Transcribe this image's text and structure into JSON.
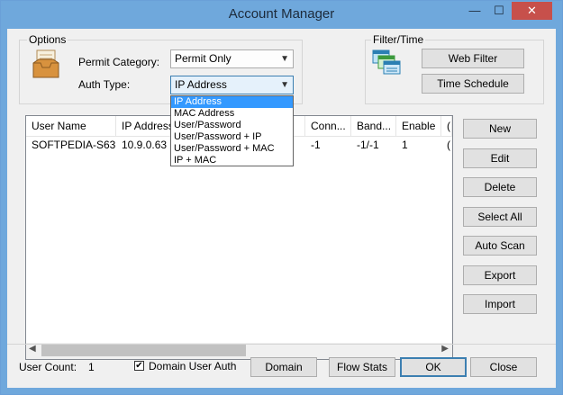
{
  "window": {
    "title": "Account Manager",
    "min_glyph": "—",
    "max_glyph": "☐",
    "close_glyph": "✕"
  },
  "options": {
    "group_label": "Options",
    "permit_category_label": "Permit Category:",
    "permit_category_value": "Permit Only",
    "auth_type_label": "Auth Type:",
    "auth_type_value": "IP Address",
    "auth_type_options": [
      "IP Address",
      "MAC Address",
      "User/Password",
      "User/Password + IP",
      "User/Password + MAC",
      "IP + MAC"
    ]
  },
  "filter": {
    "group_label": "Filter/Time",
    "web_filter_label": "Web Filter",
    "time_schedule_label": "Time Schedule"
  },
  "table": {
    "columns": [
      "User Name",
      "IP Address",
      "",
      "Conn...",
      "Band...",
      "Enable",
      "("
    ],
    "rows": [
      [
        "SOFTPEDIA-S63",
        "10.9.0.63",
        "",
        "-1",
        "-1/-1",
        "1",
        "("
      ]
    ]
  },
  "side_buttons": {
    "new": "New",
    "edit": "Edit",
    "delete": "Delete",
    "select_all": "Select All",
    "auto_scan": "Auto Scan",
    "export": "Export",
    "import": "Import"
  },
  "footer": {
    "user_count_label": "User Count:",
    "user_count_value": "1",
    "domain_user_auth_label": "Domain User Auth",
    "domain_user_auth_checked": "✔",
    "domain_label": "Domain",
    "flow_stats_label": "Flow Stats",
    "ok_label": "OK",
    "close_label": "Close"
  },
  "colors": {
    "titlebar": "#6fa8dc",
    "close_button": "#c7504b",
    "selection": "#3399ff"
  }
}
